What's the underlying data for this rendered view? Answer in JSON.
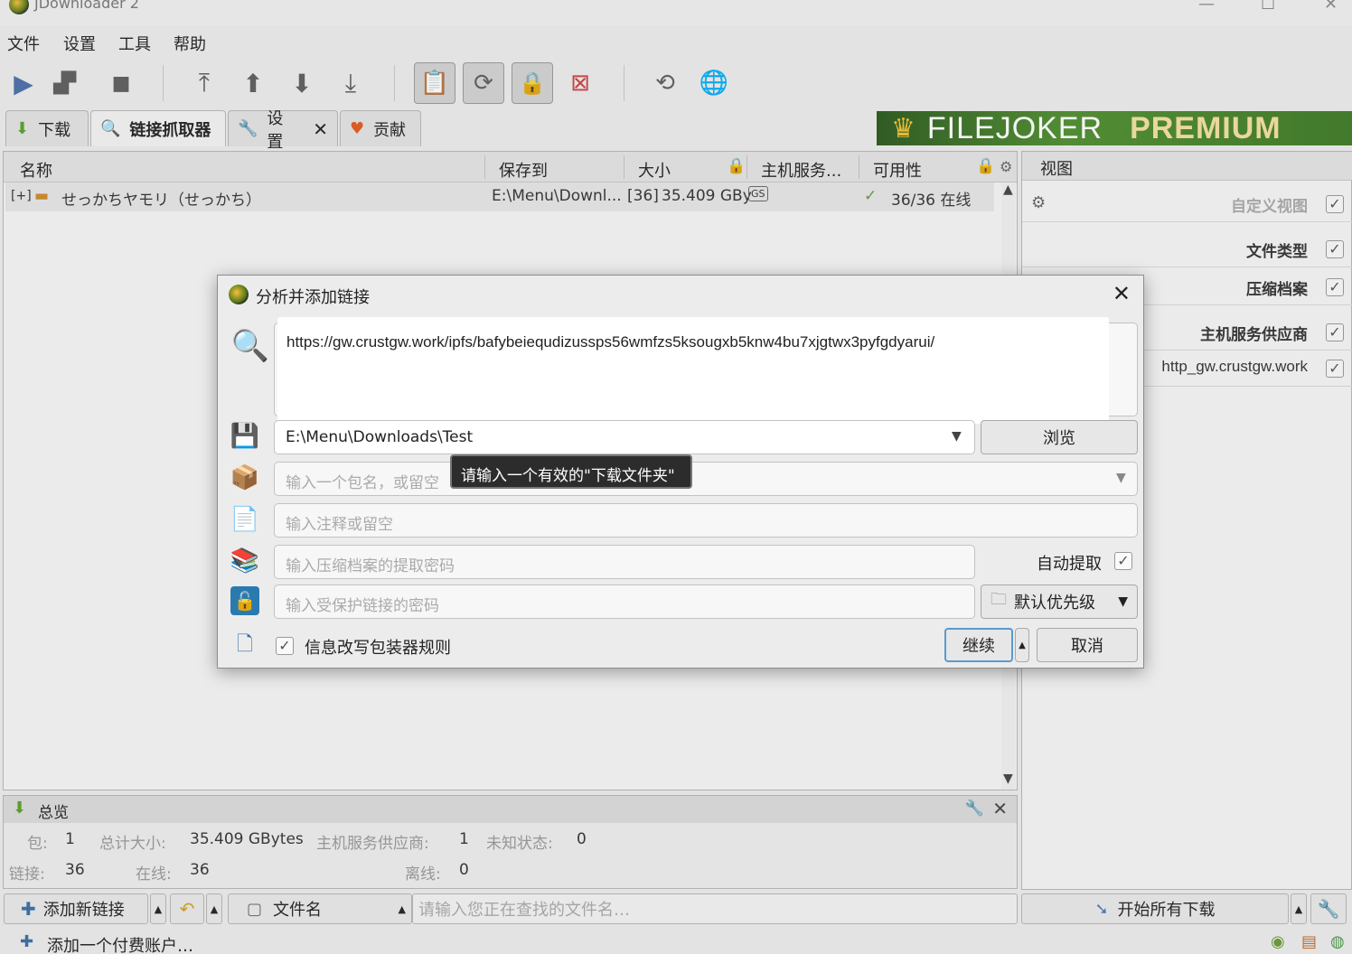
{
  "window": {
    "title": "JDownloader 2",
    "minimize": "—",
    "maximize": "☐",
    "close": "✕"
  },
  "menu": [
    "文件",
    "设置",
    "工具",
    "帮助"
  ],
  "tabs": [
    {
      "label": "下载",
      "icon": "download-arrow-icon"
    },
    {
      "label": "链接抓取器",
      "icon": "linkgrabber-magnifier-icon"
    },
    {
      "label": "设置",
      "icon": "wrench-icon"
    },
    {
      "label": "贡献",
      "icon": "heart-icon"
    }
  ],
  "banner": {
    "brand": "FILEJOKER",
    "tier": "PREMIUM"
  },
  "table": {
    "columns": [
      "名称",
      "保存到",
      "大小",
      "主机服务...",
      "可用性"
    ],
    "rows": [
      {
        "expand": "[+]",
        "name": "せっかちヤモリ（せっかち）",
        "save_to": "E:\\Menu\\Downl...",
        "count": "[36]",
        "size": "35.409 GBy",
        "host": "GS",
        "availability": "36/36 在线"
      }
    ]
  },
  "view_panel": {
    "title": "视图",
    "items": [
      {
        "label": "自定义视图",
        "checked": true,
        "dim": true
      },
      {
        "label": "文件类型",
        "checked": true
      },
      {
        "label": "压缩档案",
        "checked": true
      },
      {
        "label": "主机服务供应商",
        "checked": true
      },
      {
        "label": "http_gw.crustgw.work",
        "checked": true
      }
    ]
  },
  "overview": {
    "title": "总览",
    "packages_label": "包:",
    "packages": "1",
    "total_size_label": "总计大小:",
    "total_size": "35.409 GBytes",
    "hosters_label": "主机服务供应商:",
    "hosters": "1",
    "unknown_label": "未知状态:",
    "unknown": "0",
    "links_label": "链接:",
    "links": "36",
    "online_label": "在线:",
    "online": "36",
    "offline_label": "离线:",
    "offline": "0"
  },
  "bottom": {
    "add_links": "添加新链接",
    "filename_label": "文件名",
    "search_placeholder": "请输入您正在查找的文件名…",
    "start_all": "开始所有下载",
    "add_premium": "添加一个付费账户…"
  },
  "dialog": {
    "title": "分析并添加链接",
    "url": "https://gw.crustgw.work/ipfs/bafybeiequdizussps56wmfzs5ksougxb5knw4bu7xjgtwx3pyfgdyarui/",
    "download_folder": "E:\\Menu\\Downloads\\Test",
    "browse": "浏览",
    "package_placeholder": "输入一个包名，或留空",
    "tooltip": "请输入一个有效的\"下载文件夹\"",
    "comment_placeholder": "输入注释或留空",
    "archive_password_placeholder": "输入压缩档案的提取密码",
    "auto_extract": "自动提取",
    "auto_extract_checked": true,
    "link_password_placeholder": "输入受保护链接的密码",
    "priority": "默认优先级",
    "packagizer_rules": "信息改写包装器规则",
    "packagizer_checked": true,
    "continue": "继续",
    "cancel": "取消"
  }
}
